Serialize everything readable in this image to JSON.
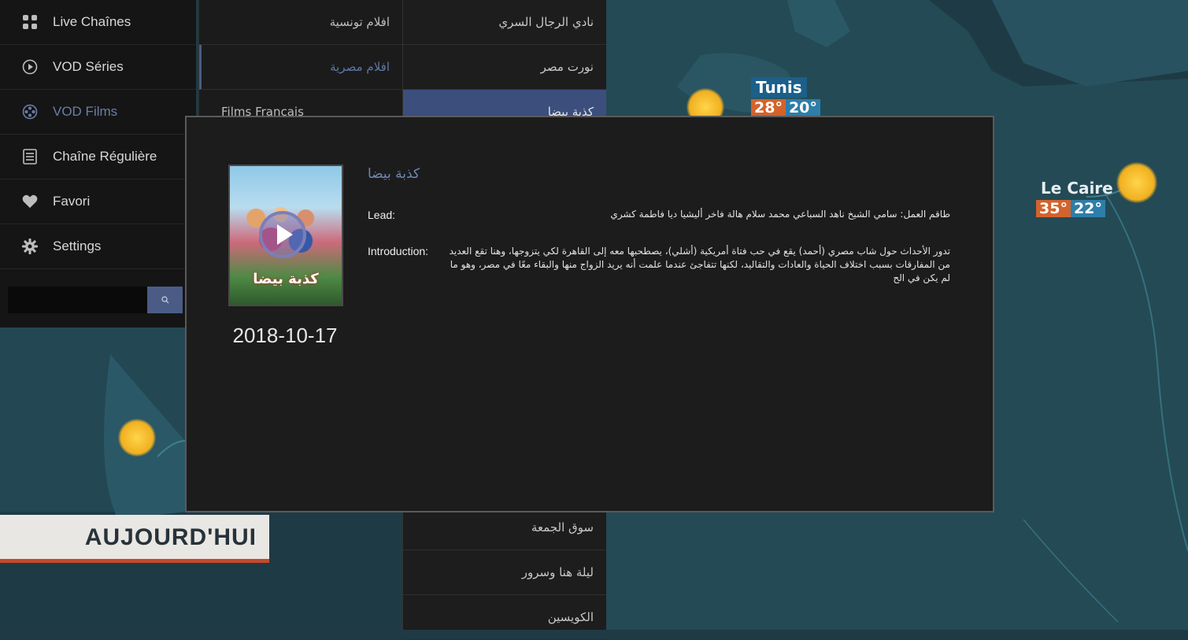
{
  "sidebar": {
    "items": [
      {
        "label": "Live Chaînes",
        "icon": "grid-icon"
      },
      {
        "label": "VOD Séries",
        "icon": "play-circle-icon"
      },
      {
        "label": "VOD Films",
        "icon": "film-reel-icon",
        "active": true
      },
      {
        "label": "Chaîne Régulière",
        "icon": "document-list-icon"
      },
      {
        "label": "Favori",
        "icon": "heart-icon"
      },
      {
        "label": "Settings",
        "icon": "gear-icon"
      }
    ],
    "search": {
      "value": "",
      "placeholder": "",
      "icon": "search-icon"
    }
  },
  "categories": {
    "items": [
      {
        "label": "افلام تونسية"
      },
      {
        "label": "افلام مصرية",
        "active": true
      },
      {
        "label": "Films Français"
      }
    ]
  },
  "films": {
    "items": [
      {
        "label": "نادي الرجال السري"
      },
      {
        "label": "نورت مصر"
      },
      {
        "label": "كذبة بيضا",
        "selected": true
      },
      {
        "label": "سوق الجمعة"
      },
      {
        "label": "ليلة هنا وسرور"
      },
      {
        "label": "الكويسين"
      }
    ]
  },
  "dialog": {
    "title": "كذبة بيضا",
    "poster_title": "كذبة بيضا",
    "release_date": "2018-10-17",
    "lead_label": "Lead:",
    "lead_value": "طاقم العمل: سامي الشيخ  ناهد السباعي  محمد سلام هالة فاخر  أليشيا ديا  فاطمة كشري",
    "intro_label": "Introduction:",
    "intro_value": "تدور الأحداث حول شاب مصري (أحمد) يقع في حب فتاة أمريكية (أشلي)، يصطحبها معه إلى القاهرة لكي يتزوجها، وهنا تقع العديد من المفارقات بسبب اختلاف الحياة والعادات والتقاليد، لكنها تتفاجئ عندما علمت أنه يريد الزواج منها والبقاء معًا في مصر، وهو ما لم يكن في الح"
  },
  "background": {
    "cities": [
      {
        "name": "Tunis",
        "hi": "28°",
        "lo": "20°"
      },
      {
        "name": "Le Caire",
        "hi": "35°",
        "lo": "22°"
      }
    ],
    "banner": "AUJOURD'HUI",
    "colors": {
      "accent": "#4a5c86",
      "selected": "#3c4e7c",
      "hot": "#d2632c",
      "cold": "#2d7ea8"
    }
  }
}
